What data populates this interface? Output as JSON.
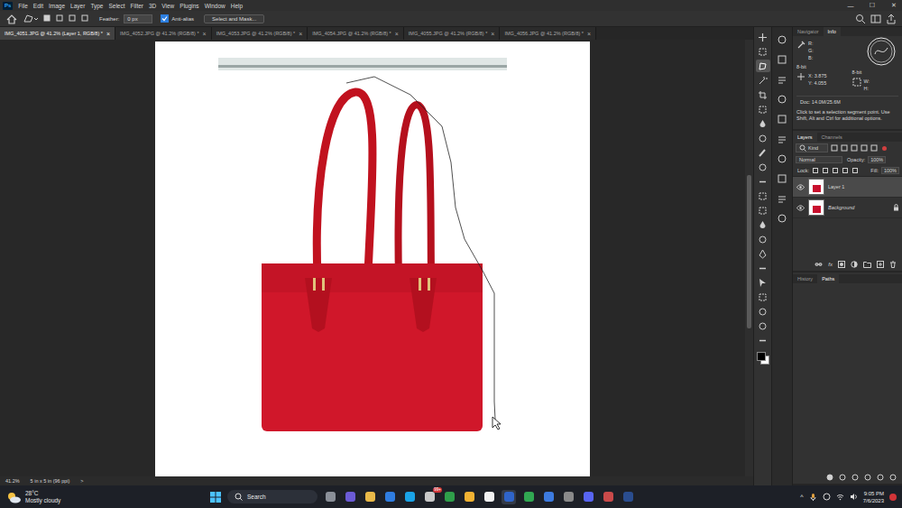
{
  "app": {
    "logo": "Ps"
  },
  "menu": [
    "File",
    "Edit",
    "Image",
    "Layer",
    "Type",
    "Select",
    "Filter",
    "3D",
    "View",
    "Plugins",
    "Window",
    "Help"
  ],
  "window_controls": [
    "—",
    "☐",
    "✕"
  ],
  "options_bar": {
    "feather_label": "Feather:",
    "feather_value": "0 px",
    "anti_alias": {
      "label": "Anti-alias",
      "checked": true
    },
    "select_mask": "Select and Mask..."
  },
  "doc_tabs": [
    {
      "label": "IMG_4051.JPG @ 41.2% (Layer 1, RGB/8) *",
      "selected": true
    },
    {
      "label": "IMG_4052.JPG @ 41.2% (RGB/8) *",
      "selected": false
    },
    {
      "label": "IMG_4053.JPG @ 41.2% (RGB/8) *",
      "selected": false
    },
    {
      "label": "IMG_4054.JPG @ 41.2% (RGB/8) *",
      "selected": false
    },
    {
      "label": "IMG_4055.JPG @ 41.2% (RGB/8) *",
      "selected": false
    },
    {
      "label": "IMG_4056.JPG @ 41.2% (RGB/8) *",
      "selected": false
    }
  ],
  "tab_close": "×",
  "status_bar": {
    "zoom": "41.2%",
    "size": "5 in x 5 in (96 ppi)",
    "arrow": ">"
  },
  "tools": [
    {
      "selected": false
    },
    {
      "selected": false
    },
    {
      "selected": true
    },
    {
      "selected": false
    },
    {
      "selected": false
    },
    {
      "selected": false
    },
    {
      "selected": false
    },
    {
      "selected": false
    },
    {
      "selected": false
    },
    {
      "selected": false
    },
    {
      "selected": false
    },
    {
      "selected": false
    },
    {
      "selected": false
    },
    {
      "selected": false
    },
    {
      "selected": false
    },
    {
      "selected": false
    },
    {
      "selected": false
    },
    {
      "selected": false
    },
    {
      "selected": false
    },
    {
      "selected": false
    },
    {
      "selected": false
    },
    {
      "selected": false
    }
  ],
  "info_panel": {
    "tabs": [
      {
        "label": "Navigator",
        "selected": false
      },
      {
        "label": "Info",
        "selected": true
      }
    ],
    "rgb": [
      "R:",
      "G:",
      "B:"
    ],
    "bit_left": "8-bit",
    "bit_right": "8-bit",
    "xy": [
      {
        "label": "X:",
        "value": "3.875"
      },
      {
        "label": "Y:",
        "value": "4.055"
      }
    ],
    "wh": [
      "W:",
      "H:"
    ],
    "doc": "Doc: 14.0M/25.6M",
    "hint": "Click to set a selection segment point. Use Shift, Alt and Ctrl for additional options."
  },
  "layers_panel": {
    "tabs": [
      {
        "label": "Layers",
        "selected": true
      },
      {
        "label": "Channels",
        "selected": false
      }
    ],
    "filter": "Kind",
    "blend": "Normal",
    "opacity_label": "Opacity:",
    "opacity": "100%",
    "lock_label": "Lock:",
    "fill_label": "Fill:",
    "fill": "100%",
    "layers": [
      {
        "name": "Layer 1",
        "selected": true,
        "visible": true,
        "locked": false
      },
      {
        "name": "Background",
        "selected": false,
        "visible": true,
        "locked": true
      }
    ],
    "fx": "fx"
  },
  "bottom_tabs": [
    {
      "label": "History",
      "selected": false
    },
    {
      "label": "Paths",
      "selected": true
    }
  ],
  "taskbar": {
    "temp": "28°C",
    "weather": "Mostly cloudy",
    "search": "Search",
    "badge": "99+",
    "tray_arrow": "^",
    "time": "9:05 PM",
    "date": "7/6/2023"
  }
}
